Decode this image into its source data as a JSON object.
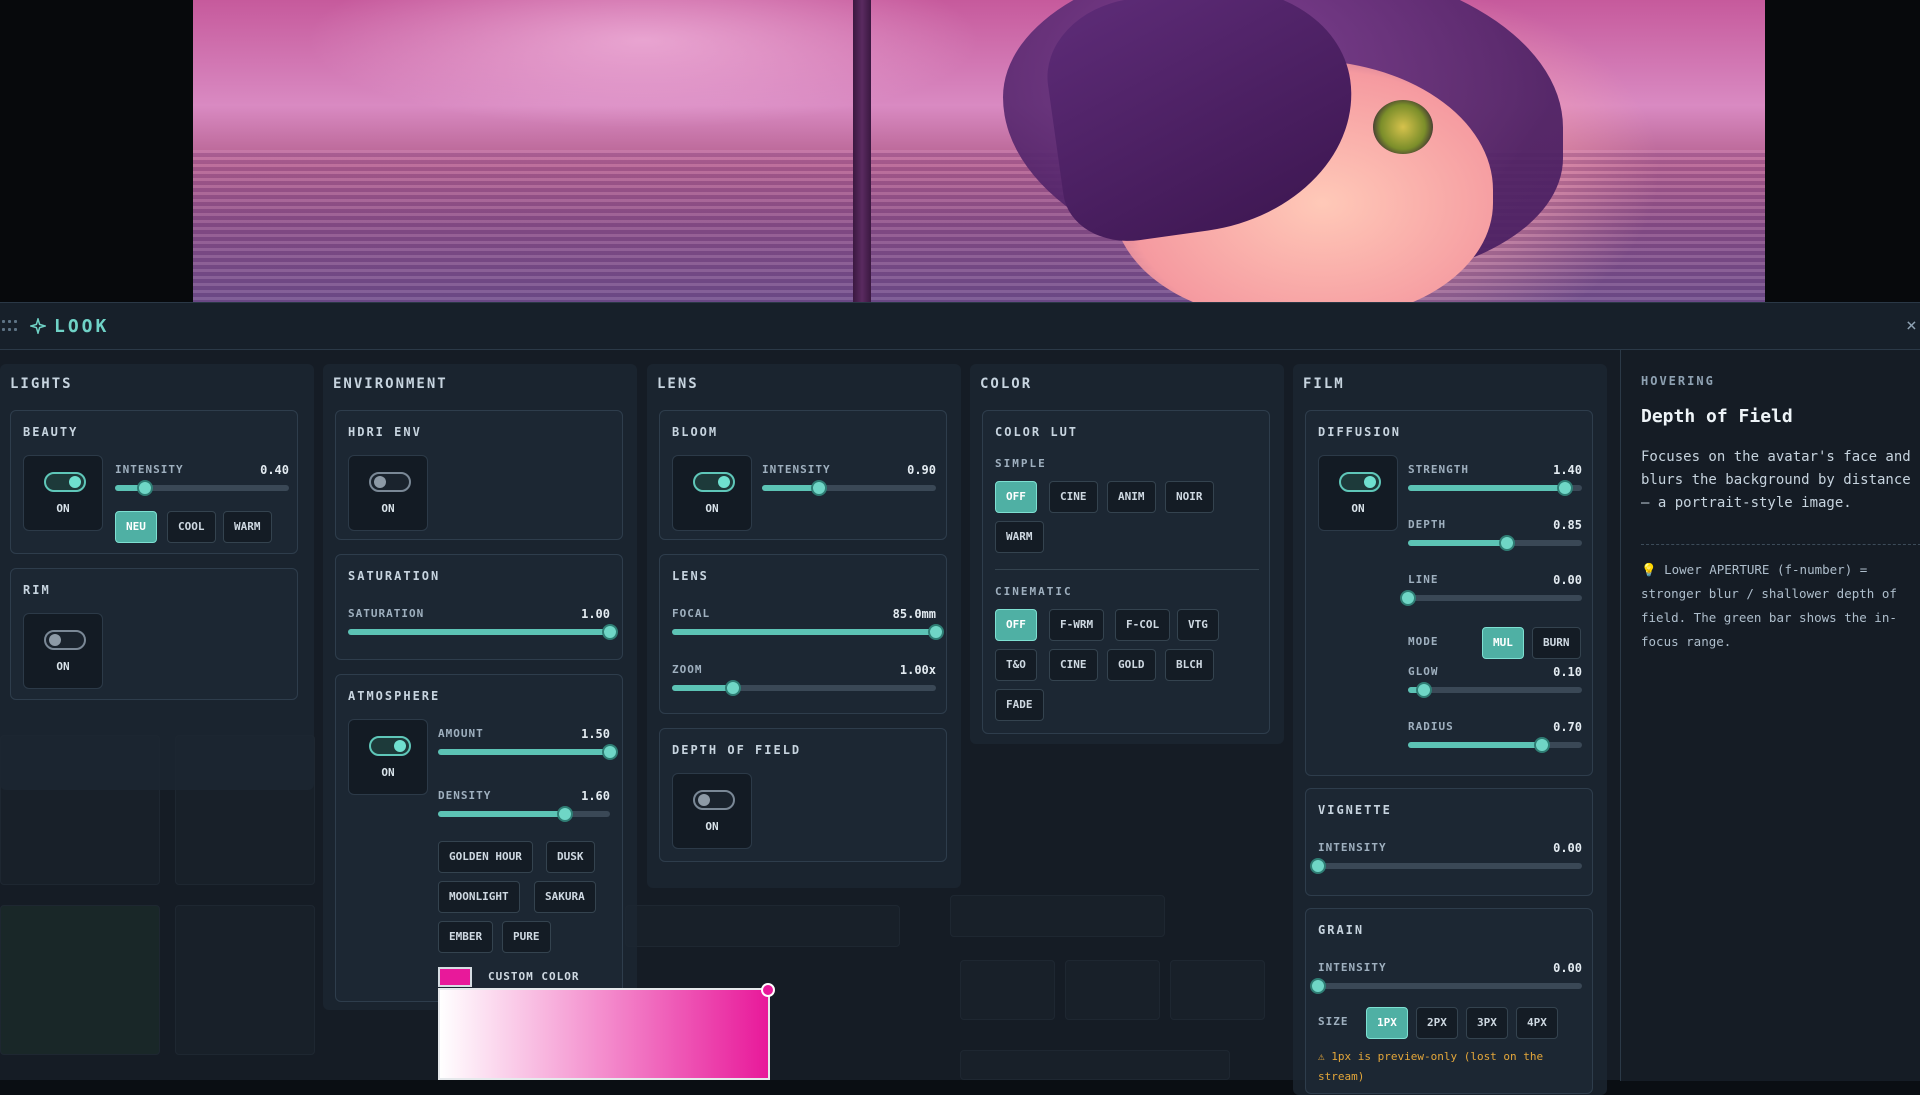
{
  "panel": {
    "title": "LOOK",
    "close": "×"
  },
  "lights": {
    "title": "LIGHTS",
    "beauty": {
      "title": "BEAUTY",
      "toggle": "ON",
      "intensity_label": "INTENSITY",
      "intensity_value": "0.40",
      "intensity": 0.17,
      "presets": [
        {
          "label": "NEU",
          "active": true
        },
        {
          "label": "COOL",
          "active": false
        },
        {
          "label": "WARM",
          "active": false
        }
      ]
    },
    "rim": {
      "title": "RIM",
      "toggle": "ON"
    }
  },
  "environment": {
    "title": "ENVIRONMENT",
    "hdri": {
      "title": "HDRI ENV",
      "toggle": "ON"
    },
    "saturation": {
      "title": "SATURATION",
      "label": "SATURATION",
      "value": "1.00",
      "level": 1.0
    },
    "atmosphere": {
      "title": "ATMOSPHERE",
      "toggle": "ON",
      "amount_label": "AMOUNT",
      "amount_value": "1.50",
      "amount": 1.0,
      "density_label": "DENSITY",
      "density_value": "1.60",
      "density": 0.74,
      "presets": [
        "GOLDEN HOUR",
        "DUSK",
        "MOONLIGHT",
        "SAKURA",
        "EMBER",
        "PURE"
      ],
      "custom_color_label": "CUSTOM COLOR",
      "custom_color": "#e8199a"
    }
  },
  "lens": {
    "title": "LENS",
    "bloom": {
      "title": "BLOOM",
      "toggle": "ON",
      "intensity_label": "INTENSITY",
      "intensity_value": "0.90",
      "intensity": 0.33
    },
    "lens": {
      "title": "LENS",
      "focal_label": "FOCAL",
      "focal_value": "85.0mm",
      "focal": 1.0,
      "zoom_label": "ZOOM",
      "zoom_value": "1.00x",
      "zoom": 0.23
    },
    "dof": {
      "title": "DEPTH OF FIELD",
      "toggle": "ON"
    }
  },
  "color": {
    "title": "COLOR",
    "lut": {
      "title": "COLOR LUT",
      "simple_label": "SIMPLE",
      "cinematic_label": "CINEMATIC",
      "simple": [
        {
          "label": "OFF",
          "active": true
        },
        {
          "label": "CINE",
          "active": false
        },
        {
          "label": "ANIM",
          "active": false
        },
        {
          "label": "NOIR",
          "active": false
        },
        {
          "label": "WARM",
          "active": false
        }
      ],
      "cinematic": [
        {
          "label": "OFF",
          "active": true
        },
        {
          "label": "F-WRM",
          "active": false
        },
        {
          "label": "F-COL",
          "active": false
        },
        {
          "label": "VTG",
          "active": false
        },
        {
          "label": "T&O",
          "active": false
        },
        {
          "label": "CINE",
          "active": false
        },
        {
          "label": "GOLD",
          "active": false
        },
        {
          "label": "BLCH",
          "active": false
        },
        {
          "label": "FADE",
          "active": false
        }
      ]
    }
  },
  "film": {
    "title": "FILM",
    "diffusion": {
      "title": "DIFFUSION",
      "toggle": "ON",
      "strength_label": "STRENGTH",
      "strength_value": "1.40",
      "strength": 0.9,
      "depth_label": "DEPTH",
      "depth_value": "0.85",
      "depth": 0.57,
      "line_label": "LINE",
      "line_value": "0.00",
      "line": 0.0,
      "mode_label": "MODE",
      "modes": [
        {
          "label": "MUL",
          "active": true
        },
        {
          "label": "BURN",
          "active": false
        }
      ],
      "glow_label": "GLOW",
      "glow_value": "0.10",
      "glow": 0.09,
      "radius_label": "RADIUS",
      "radius_value": "0.70",
      "radius": 0.77
    },
    "vignette": {
      "title": "VIGNETTE",
      "intensity_label": "INTENSITY",
      "intensity_value": "0.00",
      "intensity": 0.0
    },
    "grain": {
      "title": "GRAIN",
      "intensity_label": "INTENSITY",
      "intensity_value": "0.00",
      "intensity": 0.0,
      "size_label": "SIZE",
      "sizes": [
        {
          "label": "1PX",
          "active": true
        },
        {
          "label": "2PX",
          "active": false
        },
        {
          "label": "3PX",
          "active": false
        },
        {
          "label": "4PX",
          "active": false
        }
      ],
      "warning": "⚠ 1px is preview-only (lost on the stream)"
    }
  },
  "hover": {
    "label": "HOVERING",
    "title": "Depth of Field",
    "description": "Focuses on the avatar's face and blurs the background by distance — a portrait-style image.",
    "tip": "💡 Lower APERTURE (f-number) = stronger blur / shallower depth of field. The green bar shows the in-focus range."
  },
  "colors": {
    "accent": "#5cc3b5",
    "panel_bg": "#151c25",
    "card_bg": "#1c2733",
    "warning": "#e3a63a"
  }
}
